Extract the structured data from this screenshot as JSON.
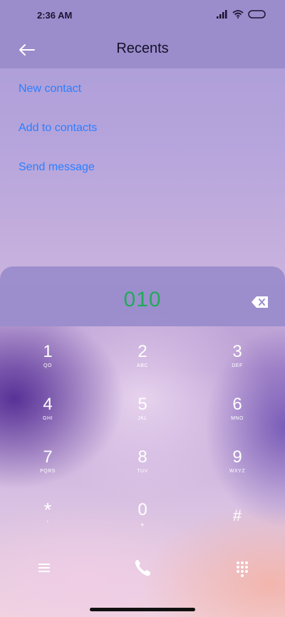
{
  "status_bar": {
    "time": "2:36 AM"
  },
  "header": {
    "title": "Recents"
  },
  "menu": {
    "new_contact": "New contact",
    "add_to_contacts": "Add to contacts",
    "send_message": "Send message"
  },
  "dialer": {
    "number": "010",
    "keys": [
      {
        "digit": "1",
        "letters": "QO"
      },
      {
        "digit": "2",
        "letters": "ABC"
      },
      {
        "digit": "3",
        "letters": "DEF"
      },
      {
        "digit": "4",
        "letters": "GHI"
      },
      {
        "digit": "5",
        "letters": "JKL"
      },
      {
        "digit": "6",
        "letters": "MNO"
      },
      {
        "digit": "7",
        "letters": "PQRS"
      },
      {
        "digit": "8",
        "letters": "TUV"
      },
      {
        "digit": "9",
        "letters": "WXYZ"
      },
      {
        "digit": "*",
        "letters": ","
      },
      {
        "digit": "0",
        "letters": "+"
      },
      {
        "digit": "#",
        "letters": ""
      }
    ]
  },
  "colors": {
    "accent_link": "#2b7fff",
    "dialed_number": "#23a95a",
    "header_bg": "#9b8ccc"
  }
}
